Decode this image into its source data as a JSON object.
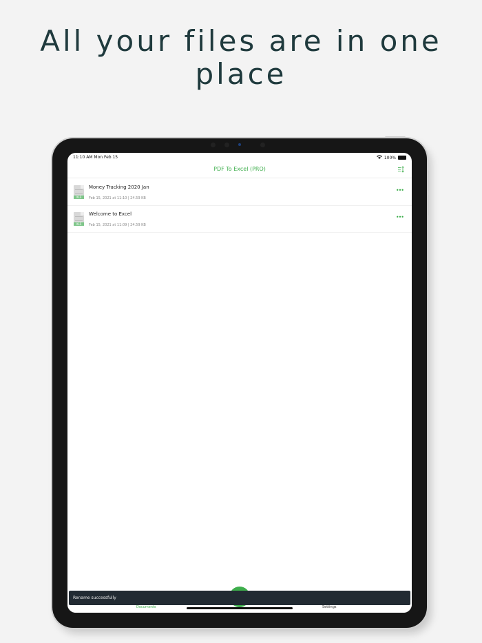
{
  "headline": "All your files are in one place",
  "status_bar": {
    "time": "11:10 AM  Mon Feb 15",
    "battery": "100%"
  },
  "nav": {
    "title": "PDF To Excel (PRO)"
  },
  "files": [
    {
      "name": "Money Tracking 2020 Jan",
      "meta": "Feb 15, 2021 at 11:10  |  24.59 KB",
      "tag": "XLS"
    },
    {
      "name": "Welcome to Excel",
      "meta": "Feb 15, 2021 at 11:09  |  24.59 KB",
      "tag": "XLS"
    }
  ],
  "toast": "Rename successfully",
  "tabs": {
    "documents": "Documents",
    "settings": "Settings"
  },
  "colors": {
    "accent": "#3eae4c",
    "headline": "#1f3a3d",
    "toast_bg": "#222b33"
  }
}
